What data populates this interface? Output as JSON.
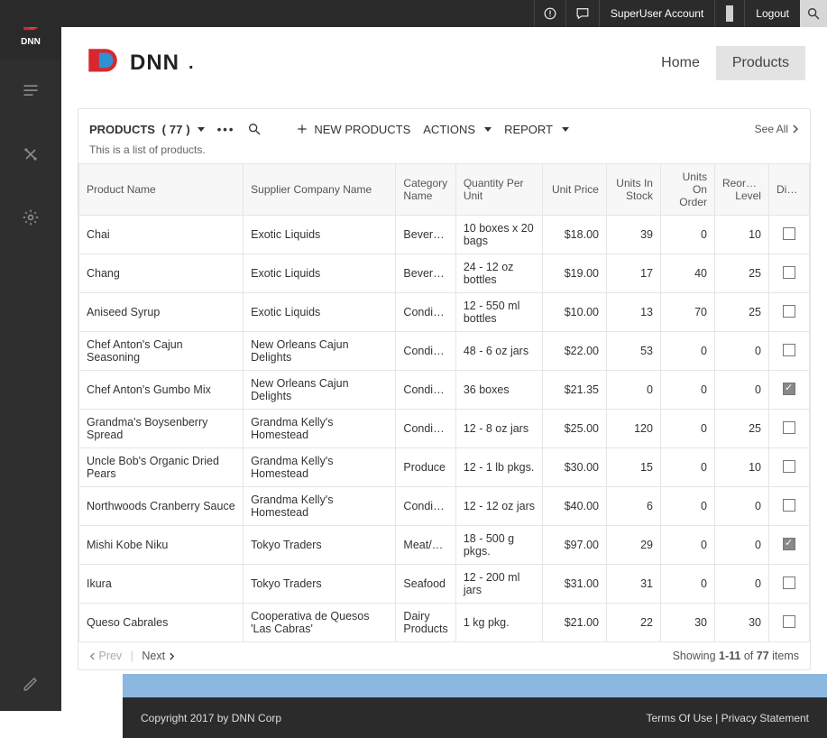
{
  "topbar": {
    "account_label": "SuperUser Account",
    "logout_label": "Logout"
  },
  "brand": {
    "text": "DNN",
    "sidebar_label": "DNN"
  },
  "nav": {
    "home": "Home",
    "products": "Products"
  },
  "toolbar": {
    "title_prefix": "PRODUCTS",
    "count": "77",
    "new_label": "NEW PRODUCTS",
    "actions_label": "ACTIONS",
    "report_label": "REPORT",
    "see_all": "See All"
  },
  "description": "This is a list of products.",
  "columns": {
    "product_name": "Product Name",
    "supplier": "Supplier Company Name",
    "category": "Category Name",
    "qty_per_unit": "Quantity Per Unit",
    "unit_price": "Unit Price",
    "units_in_stock": "Units In Stock",
    "units_on_order": "Units On Order",
    "reorder_level": "Reorder Level",
    "discontinued": "Discon."
  },
  "rows": [
    {
      "name": "Chai",
      "supplier": "Exotic Liquids",
      "category": "Beverages",
      "qpu": "10 boxes x 20 bags",
      "price": "$18.00",
      "stock": "39",
      "order": "0",
      "reorder": "10",
      "disc": false
    },
    {
      "name": "Chang",
      "supplier": "Exotic Liquids",
      "category": "Beverages",
      "qpu": "24 - 12 oz bottles",
      "price": "$19.00",
      "stock": "17",
      "order": "40",
      "reorder": "25",
      "disc": false
    },
    {
      "name": "Aniseed Syrup",
      "supplier": "Exotic Liquids",
      "category": "Condime...",
      "qpu": "12 - 550 ml bottles",
      "price": "$10.00",
      "stock": "13",
      "order": "70",
      "reorder": "25",
      "disc": false
    },
    {
      "name": "Chef Anton's Cajun Seasoning",
      "supplier": "New Orleans Cajun Delights",
      "category": "Condime...",
      "qpu": "48 - 6 oz jars",
      "price": "$22.00",
      "stock": "53",
      "order": "0",
      "reorder": "0",
      "disc": false
    },
    {
      "name": "Chef Anton's Gumbo Mix",
      "supplier": "New Orleans Cajun Delights",
      "category": "Condime...",
      "qpu": "36 boxes",
      "price": "$21.35",
      "stock": "0",
      "order": "0",
      "reorder": "0",
      "disc": true
    },
    {
      "name": "Grandma's Boysenberry Spread",
      "supplier": "Grandma Kelly's Homestead",
      "category": "Condime...",
      "qpu": "12 - 8 oz jars",
      "price": "$25.00",
      "stock": "120",
      "order": "0",
      "reorder": "25",
      "disc": false
    },
    {
      "name": "Uncle Bob's Organic Dried Pears",
      "supplier": "Grandma Kelly's Homestead",
      "category": "Produce",
      "qpu": "12 - 1 lb pkgs.",
      "price": "$30.00",
      "stock": "15",
      "order": "0",
      "reorder": "10",
      "disc": false
    },
    {
      "name": "Northwoods Cranberry Sauce",
      "supplier": "Grandma Kelly's Homestead",
      "category": "Condime...",
      "qpu": "12 - 12 oz jars",
      "price": "$40.00",
      "stock": "6",
      "order": "0",
      "reorder": "0",
      "disc": false
    },
    {
      "name": "Mishi Kobe Niku",
      "supplier": "Tokyo Traders",
      "category": "Meat/Po...",
      "qpu": "18 - 500 g pkgs.",
      "price": "$97.00",
      "stock": "29",
      "order": "0",
      "reorder": "0",
      "disc": true
    },
    {
      "name": "Ikura",
      "supplier": "Tokyo Traders",
      "category": "Seafood",
      "qpu": "12 - 200 ml jars",
      "price": "$31.00",
      "stock": "31",
      "order": "0",
      "reorder": "0",
      "disc": false
    },
    {
      "name": "Queso Cabrales",
      "supplier": "Cooperativa de Quesos 'Las Cabras'",
      "category": "Dairy Products",
      "qpu": "1 kg pkg.",
      "price": "$21.00",
      "stock": "22",
      "order": "30",
      "reorder": "30",
      "disc": false
    }
  ],
  "pager": {
    "prev": "Prev",
    "next": "Next",
    "summary_prefix": "Showing ",
    "summary_range": "1-11",
    "summary_mid": " of ",
    "summary_total": "77",
    "summary_suffix": " items"
  },
  "footer": {
    "copyright": "Copyright 2017 by DNN Corp",
    "terms": "Terms Of Use",
    "privacy": "Privacy Statement"
  }
}
